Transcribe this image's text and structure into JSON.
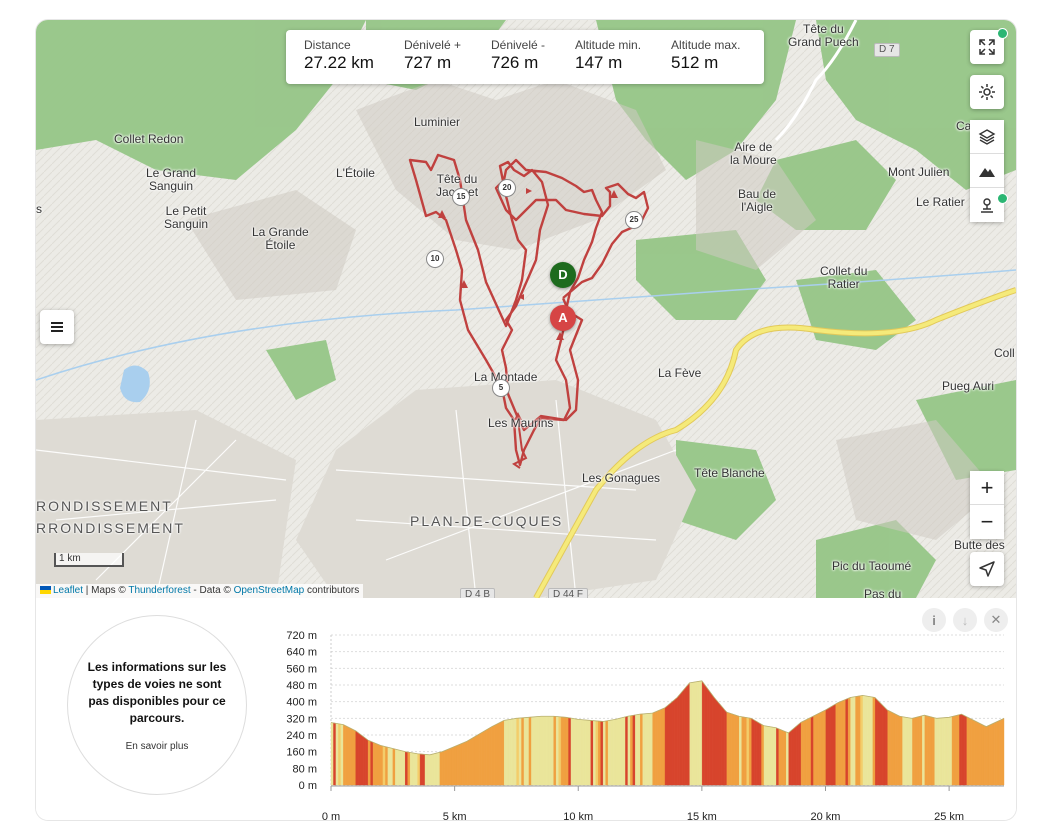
{
  "stats": [
    {
      "label": "Distance",
      "value": "27.22 km"
    },
    {
      "label": "Dénivelé +",
      "value": "727 m"
    },
    {
      "label": "Dénivelé -",
      "value": "726 m"
    },
    {
      "label": "Altitude min.",
      "value": "147 m"
    },
    {
      "label": "Altitude max.",
      "value": "512 m"
    }
  ],
  "places": {
    "tete_du_grand_puech_1": "Tête du",
    "tete_du_grand_puech_2": "Grand Puech",
    "collet_redon": "Collet Redon",
    "le_grand_sanguin_1": "Le Grand",
    "le_grand_sanguin_2": "Sanguin",
    "le_petit_sanguin_1": "Le Petit",
    "le_petit_sanguin_2": "Sanguin",
    "luminier": "Luminier",
    "l_etoile": "L'Étoile",
    "tete_du_jacquet_1": "Tête du",
    "tete_du_jacquet_2": "Jacquet",
    "la_grande_etoile_1": "La Grande",
    "la_grande_etoile_2": "Étoile",
    "aire_de_la_moure_1": "Aire de",
    "aire_de_la_moure_2": "la Moure",
    "bau_de_l_aigle_1": "Bau de",
    "bau_de_l_aigle_2": "l'Aigle",
    "mont_julien": "Mont Julien",
    "le_ratier": "Le Ratier",
    "collet_du_ratier_1": "Collet du",
    "collet_du_ratier_2": "Ratier",
    "la_montade": "La Montade",
    "les_maurins": "Les Maurins",
    "la_feve": "La Fève",
    "pueg_auri": "Pueg Auri",
    "tete_blanche": "Tête Blanche",
    "les_gonagues": "Les Gonagues",
    "arrondissement_1": "RONDISSEMENT",
    "arrondissement_2": "RRONDISSEMENT",
    "plan_de_cuques": "PLAN-DE-CUQUES",
    "butte_des": "Butte des",
    "pic_du_taoume": "Pic du Taoumé",
    "pas_du": "Pas du",
    "ca": "Ca",
    "coll": "Coll",
    "s": "s"
  },
  "roads": {
    "d7": "D 7",
    "d4b": "D 4 B",
    "d44f": "D 44 F"
  },
  "km_markers": [
    "5",
    "10",
    "15",
    "20",
    "25"
  ],
  "pins": {
    "start": "D",
    "end": "A"
  },
  "scale_label": "1 km",
  "attribution": {
    "leaflet": "Leaflet",
    "maps_prefix": " | Maps © ",
    "thunderforest": "Thunderforest",
    "data_prefix": " - Data © ",
    "osm": "OpenStreetMap",
    "suffix": " contributors"
  },
  "controls": {
    "zoom_in": "+",
    "zoom_out": "−",
    "menu": "≡"
  },
  "info": {
    "text": "Les informations sur les types de voies ne sont pas disponibles pour ce parcours.",
    "link": "En savoir plus"
  },
  "panel_buttons": {
    "info": "i",
    "download": "↓",
    "close": "✕"
  },
  "colors": {
    "route": "#c0413f",
    "forest": "#8fc27f",
    "water": "#a9cfee",
    "road_yellow": "#f5ea7a",
    "profile_flat": "#eae59a",
    "profile_mid": "#f0a040",
    "profile_steep": "#d7442c"
  },
  "chart_data": {
    "type": "area",
    "title": "",
    "xlabel": "",
    "ylabel": "",
    "xlim": [
      0,
      27.22
    ],
    "ylim": [
      0,
      720
    ],
    "y_ticks": [
      0,
      80,
      160,
      240,
      320,
      400,
      480,
      560,
      640,
      720
    ],
    "y_tick_labels": [
      "0 m",
      "80 m",
      "160 m",
      "240 m",
      "320 m",
      "400 m",
      "480 m",
      "560 m",
      "640 m",
      "720 m"
    ],
    "x_ticks": [
      0,
      5,
      10,
      15,
      20,
      25
    ],
    "x_tick_labels": [
      "0 m",
      "5 km",
      "10 km",
      "15 km",
      "20 km",
      "25 km"
    ],
    "grid": true,
    "series": [
      {
        "x": [
          0,
          0.5,
          1,
          1.5,
          2,
          2.5,
          3,
          3.5,
          4,
          4.5,
          5,
          5.5,
          6,
          6.5,
          7,
          7.5,
          8,
          8.5,
          9,
          9.5,
          10,
          10.5,
          11,
          11.5,
          12,
          12.5,
          13,
          13.5,
          14,
          14.5,
          15,
          15.5,
          16,
          16.5,
          17,
          17.5,
          18,
          18.5,
          19,
          19.5,
          20,
          20.5,
          21,
          21.5,
          22,
          22.5,
          23,
          23.5,
          24,
          24.5,
          25,
          25.5,
          26,
          26.5,
          27.22
        ],
        "y": [
          300,
          290,
          260,
          215,
          190,
          175,
          160,
          150,
          145,
          160,
          185,
          210,
          245,
          280,
          310,
          320,
          325,
          330,
          330,
          325,
          315,
          310,
          305,
          315,
          330,
          340,
          345,
          370,
          420,
          490,
          500,
          420,
          350,
          330,
          320,
          285,
          275,
          250,
          300,
          330,
          360,
          395,
          420,
          430,
          420,
          360,
          330,
          320,
          335,
          320,
          325,
          340,
          310,
          280,
          320
        ]
      }
    ]
  }
}
